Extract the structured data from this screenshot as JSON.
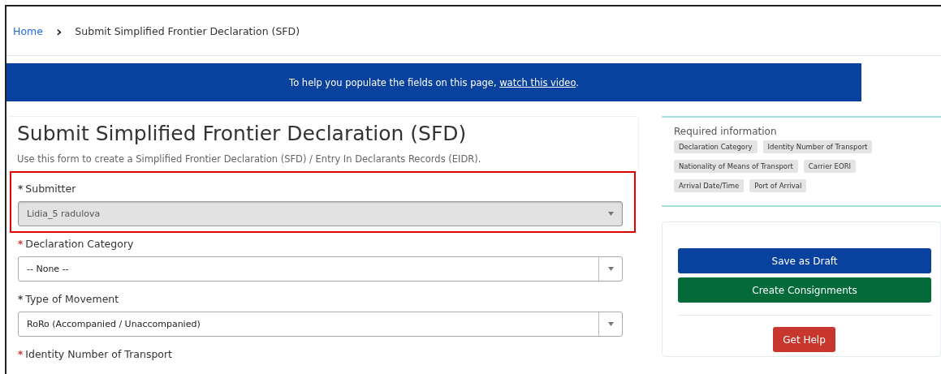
{
  "breadcrumb": {
    "home": "Home",
    "separator": "›",
    "current": "Submit Simplified Frontier Declaration (SFD)"
  },
  "banner": {
    "text": "To help you populate the fields on this page, ",
    "link": "watch this video",
    "end": "."
  },
  "form": {
    "title": "Submit Simplified Frontier Declaration (SFD)",
    "description": "Use this form to create a Simplified Frontier Declaration (SFD) / Entry In Declarants Records (EIDR).",
    "fields": [
      {
        "label": "Submitter",
        "required": "*",
        "color": "#444444",
        "value": "Lidia_5 radulova",
        "disabled": true,
        "highlighted": true
      },
      {
        "label": "Declaration Category",
        "required": "*",
        "color": "#c23934",
        "value": "-- None --",
        "disabled": false,
        "highlighted": false
      },
      {
        "label": "Type of Movement",
        "required": "*",
        "color": "#444444",
        "value": "RoRo (Accompanied / Unaccompanied)",
        "disabled": false,
        "highlighted": false
      },
      {
        "label": "Identity Number of Transport",
        "required": "*",
        "color": "#c23934"
      }
    ]
  },
  "required_info": {
    "title": "Required information",
    "tags": [
      "Declaration Category",
      "Identity Number of Transport",
      "Nationality of Means of Transport",
      "Carrier EORI",
      "Arrival Date/Time",
      "Port of Arrival"
    ]
  },
  "actions": [
    {
      "label": "Save as Draft",
      "kind": "primary"
    },
    {
      "label": "Create Consignments",
      "kind": "success"
    },
    {
      "label": "Get Help",
      "kind": "help"
    }
  ]
}
